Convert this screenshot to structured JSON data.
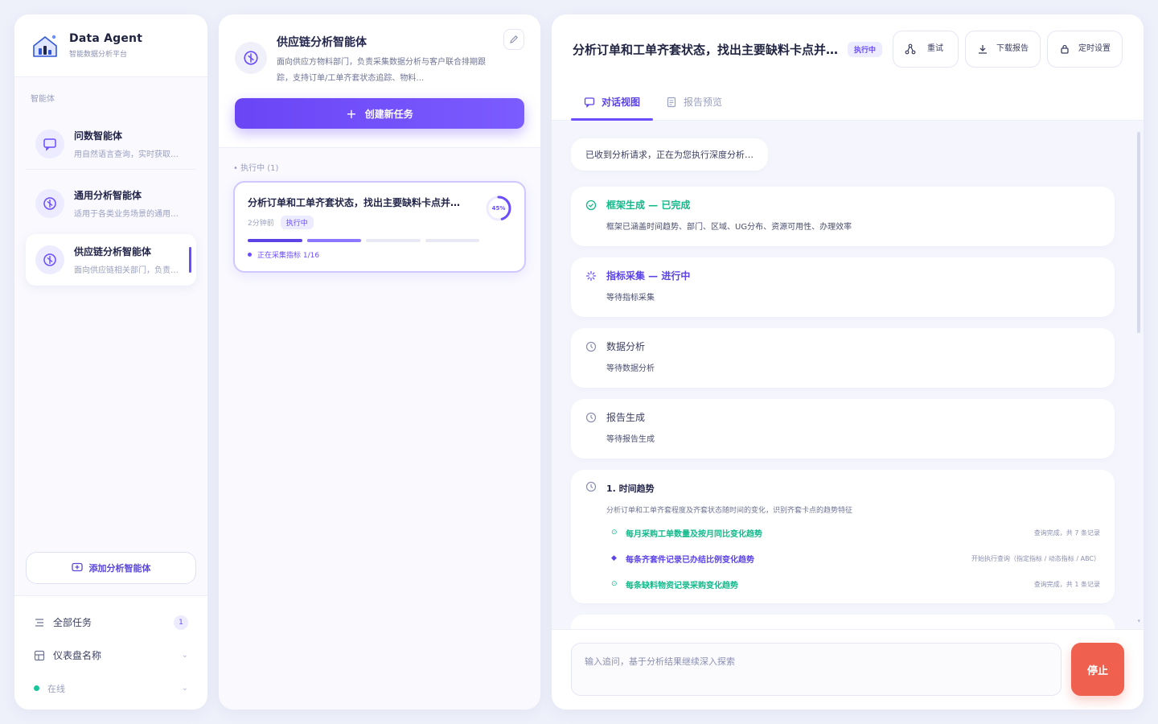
{
  "colors": {
    "accent": "#6b4dff",
    "success": "#13b98a",
    "danger": "#f0604e",
    "background": "#eef0fa"
  },
  "brand": {
    "title": "Data Agent",
    "subtitle": "智能数据分析平台",
    "logo_icon": "house-chart-logo"
  },
  "sidebar": {
    "section_label": "智能体",
    "agents": [
      {
        "name": "问数智能体",
        "desc": "用自然语言查询，实时获取数据",
        "icon": "chat-icon"
      },
      {
        "name": "通用分析智能体",
        "desc": "适用于各类业务场景的通用分析",
        "icon": "compass-icon"
      },
      {
        "name": "供应链分析智能体",
        "desc": "面向供应链相关部门，负责分析",
        "icon": "compass-icon"
      }
    ],
    "add_agent_label": "添加分析智能体",
    "footer": {
      "all_tasks_label": "全部任务",
      "all_tasks_count": "1",
      "dashboard_label": "仪表盘名称",
      "status_label": "在线"
    }
  },
  "task_panel": {
    "agent_title": "供应链分析智能体",
    "agent_desc": "面向供应方物料部门，负责采集数据分析与客户联合排期跟踪，支持订单/工单齐套状态追踪、物料…",
    "create_label": "创建新任务",
    "group_label": "执行中 (1)",
    "task": {
      "title": "分析订单和工单齐套状态，找出主要缺料卡点并给出建议",
      "time": "2分钟前",
      "status": "执行中",
      "progress_pct": 45,
      "progress_label": "45%",
      "step_text": "正在采集指标 1/16"
    }
  },
  "detail": {
    "title": "分析订单和工单齐套状态，找出主要缺料卡点并…",
    "status": "执行中",
    "actions": [
      {
        "label": "重试",
        "icon": "share-icon"
      },
      {
        "label": "下载报告",
        "icon": "download-icon"
      },
      {
        "label": "定时设置",
        "icon": "lock-icon"
      }
    ],
    "tabs": [
      {
        "label": "对话视图",
        "icon": "chat-icon"
      },
      {
        "label": "报告预览",
        "icon": "document-icon"
      }
    ],
    "intro_message": "已收到分析请求，正在为您执行深度分析…",
    "steps": [
      {
        "title": "框架生成 — 已完成",
        "sub": "框架已涵盖时间趋势、部门、区域、UG分布、资源可用性、办理效率",
        "state": "done"
      },
      {
        "title": "指标采集 — 进行中",
        "sub": "等待指标采集",
        "state": "active"
      },
      {
        "title": "数据分析",
        "sub": "等待数据分析",
        "state": "pending"
      },
      {
        "title": "报告生成",
        "sub": "等待报告生成",
        "state": "pending"
      }
    ],
    "plan": {
      "title": "1. 时间趋势",
      "desc": "分析订单和工单齐套程度及齐套状态随时间的变化，识别齐套卡点的趋势特征",
      "items": [
        {
          "title": "每月采购工单数量及按月同比变化趋势",
          "meta": "查询完成，共 7 条记录",
          "state": "ok"
        },
        {
          "title": "每条齐套件记录已办结比例变化趋势",
          "meta": "开始执行查询（指定指标 / 动态指标 / ABC）",
          "state": "run"
        },
        {
          "title": "每条缺料物资记录采购变化趋势",
          "meta": "查询完成，共 1 条记录",
          "state": "ok"
        }
      ]
    },
    "composer": {
      "placeholder": "输入追问，基于分析结果继续深入探索",
      "stop_label": "停止"
    }
  }
}
